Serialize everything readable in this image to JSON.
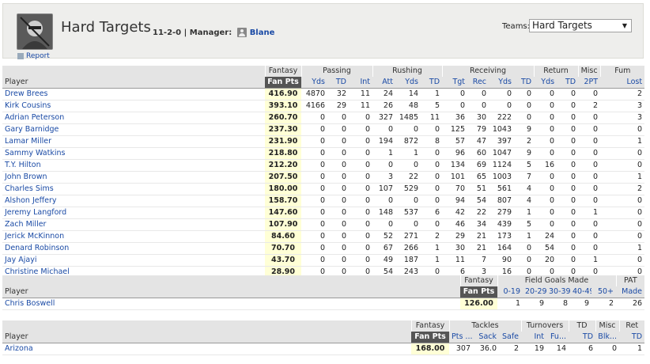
{
  "team": {
    "name": "Hard Targets",
    "record": "11-2-0",
    "manager_label": "Manager:",
    "manager_name": "Blane",
    "report_label": "Report"
  },
  "teams_select": {
    "label": "Teams:",
    "value": "Hard Targets"
  },
  "offense": {
    "groups": [
      "Fantasy",
      "Passing",
      "Rushing",
      "Receiving",
      "Return",
      "Misc",
      "Fum"
    ],
    "columns": [
      "Player",
      "Fan Pts",
      "Yds",
      "TD",
      "Int",
      "Att",
      "Yds",
      "TD",
      "Tgt",
      "Rec",
      "Yds",
      "TD",
      "Yds",
      "TD",
      "2PT",
      "Lost"
    ],
    "rows": [
      [
        "Drew Brees",
        "416.90",
        "4870",
        "32",
        "11",
        "24",
        "14",
        "1",
        "0",
        "0",
        "0",
        "0",
        "0",
        "0",
        "0",
        "2"
      ],
      [
        "Kirk Cousins",
        "393.10",
        "4166",
        "29",
        "11",
        "26",
        "48",
        "5",
        "0",
        "0",
        "0",
        "0",
        "0",
        "0",
        "2",
        "3"
      ],
      [
        "Adrian Peterson",
        "260.70",
        "0",
        "0",
        "0",
        "327",
        "1485",
        "11",
        "36",
        "30",
        "222",
        "0",
        "0",
        "0",
        "0",
        "3"
      ],
      [
        "Gary Barnidge",
        "237.30",
        "0",
        "0",
        "0",
        "0",
        "0",
        "0",
        "125",
        "79",
        "1043",
        "9",
        "0",
        "0",
        "0",
        "0"
      ],
      [
        "Lamar Miller",
        "231.90",
        "0",
        "0",
        "0",
        "194",
        "872",
        "8",
        "57",
        "47",
        "397",
        "2",
        "0",
        "0",
        "0",
        "1"
      ],
      [
        "Sammy Watkins",
        "218.80",
        "0",
        "0",
        "0",
        "1",
        "1",
        "0",
        "96",
        "60",
        "1047",
        "9",
        "0",
        "0",
        "0",
        "0"
      ],
      [
        "T.Y. Hilton",
        "212.20",
        "0",
        "0",
        "0",
        "0",
        "0",
        "0",
        "134",
        "69",
        "1124",
        "5",
        "16",
        "0",
        "0",
        "0"
      ],
      [
        "John Brown",
        "207.50",
        "0",
        "0",
        "0",
        "3",
        "22",
        "0",
        "101",
        "65",
        "1003",
        "7",
        "0",
        "0",
        "0",
        "1"
      ],
      [
        "Charles Sims",
        "180.00",
        "0",
        "0",
        "0",
        "107",
        "529",
        "0",
        "70",
        "51",
        "561",
        "4",
        "0",
        "0",
        "0",
        "2"
      ],
      [
        "Alshon Jeffery",
        "158.70",
        "0",
        "0",
        "0",
        "0",
        "0",
        "0",
        "94",
        "54",
        "807",
        "4",
        "0",
        "0",
        "0",
        "0"
      ],
      [
        "Jeremy Langford",
        "147.60",
        "0",
        "0",
        "0",
        "148",
        "537",
        "6",
        "42",
        "22",
        "279",
        "1",
        "0",
        "0",
        "1",
        "0"
      ],
      [
        "Zach Miller",
        "107.90",
        "0",
        "0",
        "0",
        "0",
        "0",
        "0",
        "46",
        "34",
        "439",
        "5",
        "0",
        "0",
        "0",
        "0"
      ],
      [
        "Jerick McKinnon",
        "84.60",
        "0",
        "0",
        "0",
        "52",
        "271",
        "2",
        "29",
        "21",
        "173",
        "1",
        "24",
        "0",
        "0",
        "0"
      ],
      [
        "Denard Robinson",
        "70.70",
        "0",
        "0",
        "0",
        "67",
        "266",
        "1",
        "30",
        "21",
        "164",
        "0",
        "54",
        "0",
        "0",
        "1"
      ],
      [
        "Jay Ajayi",
        "43.70",
        "0",
        "0",
        "0",
        "49",
        "187",
        "1",
        "11",
        "7",
        "90",
        "0",
        "20",
        "0",
        "1",
        "0"
      ],
      [
        "Christine Michael",
        "28.90",
        "0",
        "0",
        "0",
        "54",
        "243",
        "0",
        "6",
        "3",
        "16",
        "0",
        "0",
        "0",
        "0",
        "0"
      ]
    ]
  },
  "kicker": {
    "groups": [
      "Fantasy",
      "Field Goals Made",
      "PAT"
    ],
    "columns": [
      "Player",
      "Fan Pts",
      "0-19",
      "20-29",
      "30-39",
      "40-49",
      "50+",
      "Made"
    ],
    "rows": [
      [
        "Chris Boswell",
        "126.00",
        "1",
        "9",
        "8",
        "9",
        "2",
        "26"
      ]
    ]
  },
  "defense": {
    "groups": [
      "Fantasy",
      "Tackles",
      "Turnovers",
      "TD",
      "Misc",
      "Ret"
    ],
    "columns": [
      "Player",
      "Fan Pts",
      "Pts ...",
      "Sack",
      "Safe",
      "Int",
      "Fu...",
      "TD",
      "Blk...",
      "TD"
    ],
    "rows": [
      [
        "Arizona",
        "168.00",
        "307",
        "36.0",
        "2",
        "19",
        "14",
        "6",
        "0",
        "1"
      ]
    ]
  }
}
